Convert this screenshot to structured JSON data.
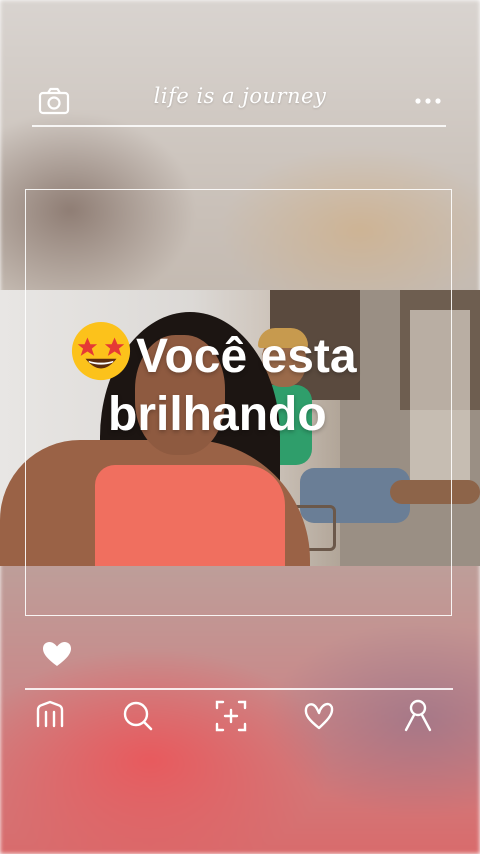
{
  "header": {
    "tagline": "life is a journey",
    "camera_icon": "camera-icon",
    "more_icon": "more-horizontal-icon"
  },
  "photo": {
    "caption_line1": "Você esta",
    "caption_line2": "brilhando",
    "emoji": "star-struck-emoji"
  },
  "actions": {
    "like_icon": "heart-icon"
  },
  "bottom_nav": {
    "items": [
      {
        "icon": "home-icon"
      },
      {
        "icon": "search-icon"
      },
      {
        "icon": "add-post-icon"
      },
      {
        "icon": "heart-icon"
      },
      {
        "icon": "profile-icon"
      }
    ]
  },
  "colors": {
    "accent_white": "#ffffff",
    "top_coral": "#f06f5f"
  }
}
